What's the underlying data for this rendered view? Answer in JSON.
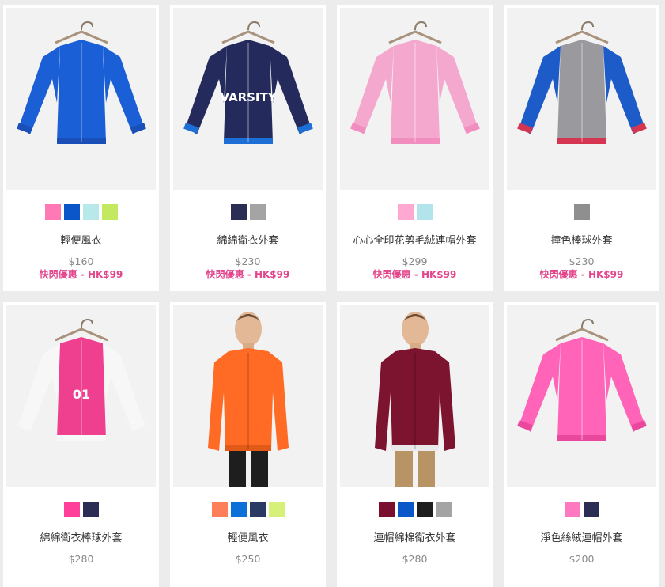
{
  "products": [
    {
      "name": "輕便風衣",
      "price": "$160",
      "promo": "快閃優惠 - HK$99",
      "swatches": [
        "#ff79b4",
        "#0b57c9",
        "#b7e9ea",
        "#c2e95f"
      ],
      "photo": {
        "type": "hanger",
        "main": "#1b5fd6",
        "sleeve": "#1b5fd6",
        "trim": "#1a4fb8"
      }
    },
    {
      "name": "綿綿衛衣外套",
      "price": "$230",
      "promo": "快閃優惠 - HK$99",
      "swatches": [
        "#2b2d55",
        "#a4a4a4"
      ],
      "photo": {
        "type": "hanger",
        "main": "#242a5b",
        "sleeve": "#242a5b",
        "trim": "#1d6fd6",
        "text": "VARSITY"
      }
    },
    {
      "name": "心心全印花剪毛絨連帽外套",
      "price": "$299",
      "promo": "快閃優惠 - HK$99",
      "swatches": [
        "#ffa8d2",
        "#b3e4ec"
      ],
      "photo": {
        "type": "hanger",
        "main": "#f4a8cd",
        "sleeve": "#f4a8cd",
        "trim": "#f28dbf"
      }
    },
    {
      "name": "撞色棒球外套",
      "price": "$230",
      "promo": "快閃優惠 - HK$99",
      "swatches": [
        "#8f8f8f"
      ],
      "photo": {
        "type": "hanger",
        "main": "#9a9a9e",
        "sleeve": "#1d5bc9",
        "trim": "#d43652"
      }
    },
    {
      "name": "綿綿衛衣棒球外套",
      "price": "$280",
      "promo": "",
      "swatches": [
        "#ff3f9a",
        "#2b2d55"
      ],
      "photo": {
        "type": "hanger",
        "main": "#ef3f8f",
        "sleeve": "#f7f7f7",
        "trim": "#f7f7f7",
        "text": "01"
      }
    },
    {
      "name": "輕便風衣",
      "price": "$250",
      "promo": "",
      "swatches": [
        "#ff7e5a",
        "#0d6fd8",
        "#2b3a63",
        "#d6f07a"
      ],
      "photo": {
        "type": "model",
        "main": "#ff6a24",
        "trim": "#e25a18",
        "pants": "#1e1e1e"
      }
    },
    {
      "name": "連帽綿棉衛衣外套",
      "price": "$280",
      "promo": "",
      "swatches": [
        "#7a0f2e",
        "#0b57c9",
        "#1e1e1e",
        "#a4a4a4"
      ],
      "photo": {
        "type": "model",
        "main": "#7c1430",
        "trim": "#e9e9e9",
        "pants": "#b89363"
      }
    },
    {
      "name": "淨色絲絨連帽外套",
      "price": "$200",
      "promo": "",
      "swatches": [
        "#ff79c0",
        "#2b2d55"
      ],
      "photo": {
        "type": "hanger",
        "main": "#ff64b8",
        "sleeve": "#ff64b8",
        "trim": "#e9489d"
      }
    }
  ]
}
